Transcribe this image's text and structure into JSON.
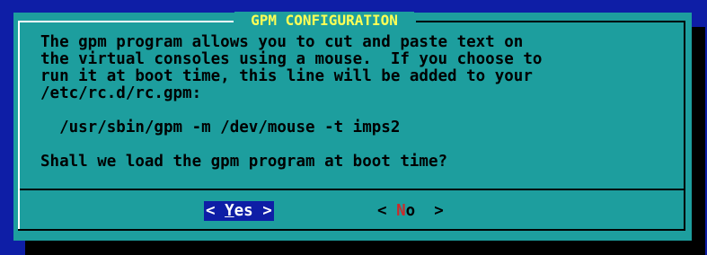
{
  "dialog": {
    "title": "GPM CONFIGURATION",
    "body_lines": [
      "The gpm program allows you to cut and paste text on",
      "the virtual consoles using a mouse.  If you choose to",
      "run it at boot time, this line will be added to your",
      "/etc/rc.d/rc.gpm:",
      "",
      "  /usr/sbin/gpm -m /dev/mouse -t imps2",
      "",
      "Shall we load the gpm program at boot time?"
    ]
  },
  "buttons": {
    "yes": {
      "open": "< ",
      "hotkey": "Y",
      "rest": "es",
      "close": " >",
      "selected": true
    },
    "no": {
      "open": "< ",
      "hotkey": "N",
      "rest": "o",
      "close": "  >",
      "selected": false
    }
  },
  "colors": {
    "screen_bg": "#0e1ea6",
    "dialog_bg": "#1d9e9e",
    "title": "#ffff55",
    "selected_button_bg": "#0e1ea6",
    "no_hotkey": "#cc2a2a"
  }
}
